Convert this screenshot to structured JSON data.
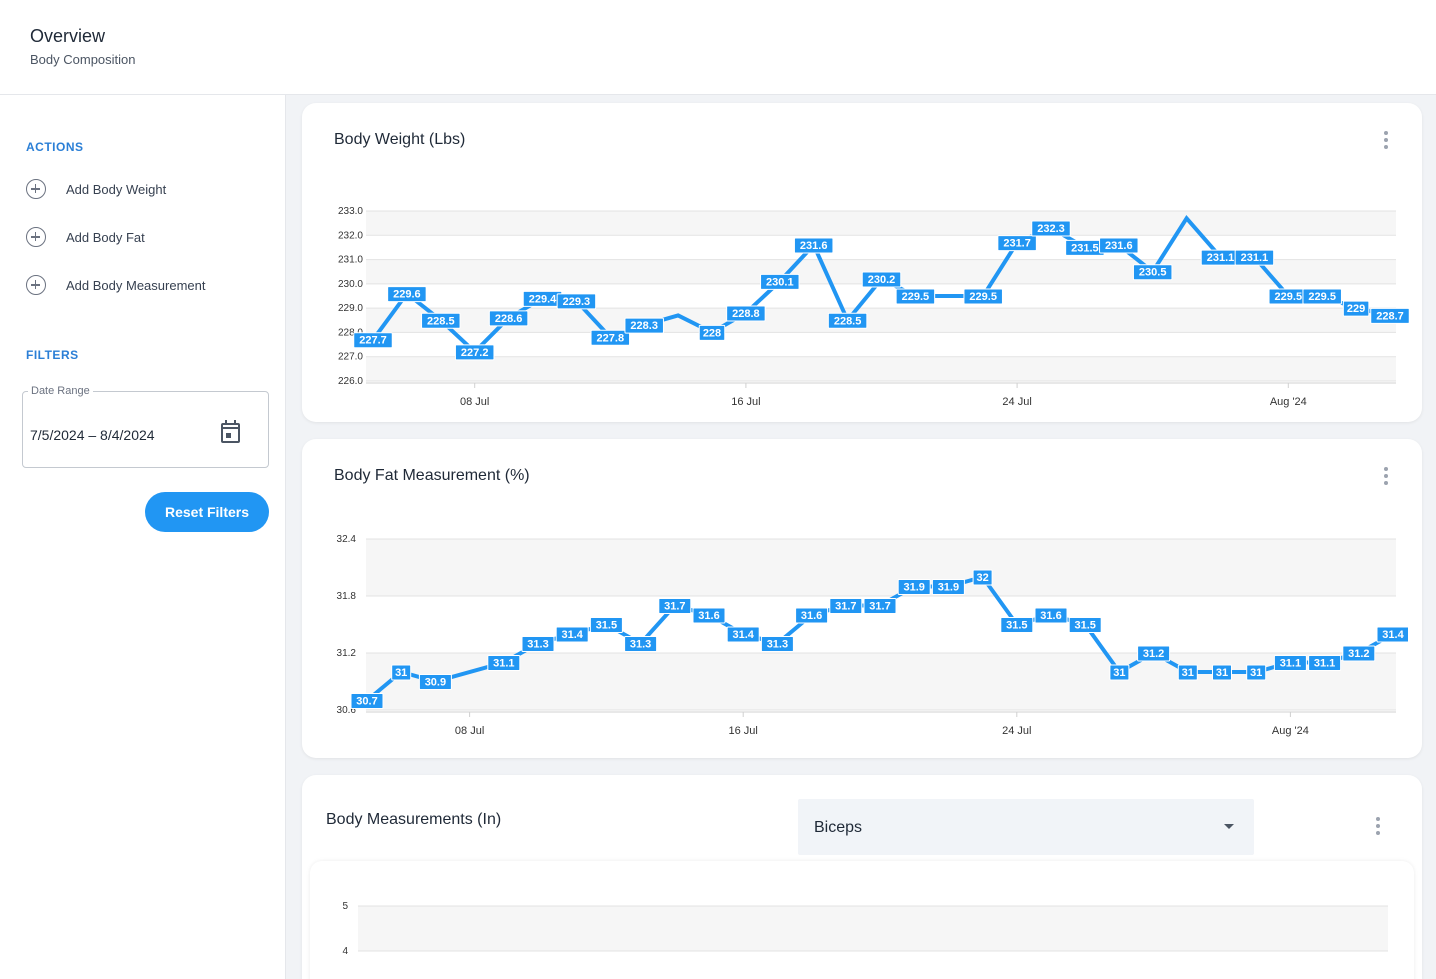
{
  "header": {
    "title": "Overview",
    "subtitle": "Body Composition"
  },
  "sidebar": {
    "actions_heading": "ACTIONS",
    "actions": [
      {
        "label": "Add Body Weight",
        "icon": "add-circle-icon"
      },
      {
        "label": "Add Body Fat",
        "icon": "add-circle-icon"
      },
      {
        "label": "Add Body Measurement",
        "icon": "add-circle-icon"
      }
    ],
    "filters_heading": "FILTERS",
    "date_range": {
      "label": "Date Range",
      "value": "7/5/2024 – 8/4/2024",
      "icon": "calendar-icon"
    },
    "reset_label": "Reset Filters"
  },
  "colors": {
    "accent": "#2196f3",
    "line": "#2196f3",
    "label_bg": "#2196f3",
    "heading": "#2b7fd6"
  },
  "cards": {
    "weight": {
      "title": "Body Weight (Lbs)"
    },
    "fat": {
      "title": "Body Fat Measurement (%)"
    },
    "measure": {
      "title": "Body Measurements (In)",
      "select_value": "Biceps"
    }
  },
  "chart_data": [
    {
      "type": "line",
      "title": "Body Weight (Lbs)",
      "x_start": "2024-07-05",
      "x_ticks": [
        {
          "label": "08 Jul",
          "x": "2024-07-08"
        },
        {
          "label": "16 Jul",
          "x": "2024-07-16"
        },
        {
          "label": "24 Jul",
          "x": "2024-07-24"
        },
        {
          "label": "Aug '24",
          "x": "2024-08-01"
        }
      ],
      "y_ticks": [
        "233.0",
        "232.0",
        "231.0",
        "230.0",
        "229.0",
        "228.0",
        "227.0",
        "226.0"
      ],
      "ylim": [
        226,
        233
      ],
      "grid": true,
      "series": [
        {
          "points": [
            {
              "x": "2024-07-05",
              "y": 227.7,
              "label": "227.7"
            },
            {
              "x": "2024-07-06",
              "y": 229.6,
              "label": "229.6"
            },
            {
              "x": "2024-07-07",
              "y": 228.5,
              "label": "228.5"
            },
            {
              "x": "2024-07-08",
              "y": 227.2,
              "label": "227.2"
            },
            {
              "x": "2024-07-09",
              "y": 228.6,
              "label": "228.6"
            },
            {
              "x": "2024-07-10",
              "y": 229.4,
              "label": "229.4"
            },
            {
              "x": "2024-07-11",
              "y": 229.3,
              "label": "229.3"
            },
            {
              "x": "2024-07-12",
              "y": 227.8,
              "label": "227.8"
            },
            {
              "x": "2024-07-13",
              "y": 228.3,
              "label": "228.3"
            },
            {
              "x": "2024-07-14",
              "y": 228.7,
              "label": null
            },
            {
              "x": "2024-07-15",
              "y": 228,
              "label": "228"
            },
            {
              "x": "2024-07-16",
              "y": 228.8,
              "label": "228.8"
            },
            {
              "x": "2024-07-17",
              "y": 230.1,
              "label": "230.1"
            },
            {
              "x": "2024-07-18",
              "y": 231.6,
              "label": "231.6"
            },
            {
              "x": "2024-07-19",
              "y": 228.5,
              "label": "228.5"
            },
            {
              "x": "2024-07-20",
              "y": 230.2,
              "label": "230.2"
            },
            {
              "x": "2024-07-21",
              "y": 229.5,
              "label": "229.5"
            },
            {
              "x": "2024-07-23",
              "y": 229.5,
              "label": "229.5"
            },
            {
              "x": "2024-07-24",
              "y": 231.7,
              "label": "231.7"
            },
            {
              "x": "2024-07-25",
              "y": 232.3,
              "label": "232.3"
            },
            {
              "x": "2024-07-26",
              "y": 231.5,
              "label": "231.5"
            },
            {
              "x": "2024-07-27",
              "y": 231.6,
              "label": "231.6"
            },
            {
              "x": "2024-07-28",
              "y": 230.5,
              "label": "230.5"
            },
            {
              "x": "2024-07-29",
              "y": 232.7,
              "label": null
            },
            {
              "x": "2024-07-30",
              "y": 231.1,
              "label": "231.1"
            },
            {
              "x": "2024-07-31",
              "y": 231.1,
              "label": "231.1"
            },
            {
              "x": "2024-08-01",
              "y": 229.5,
              "label": "229.5"
            },
            {
              "x": "2024-08-02",
              "y": 229.5,
              "label": "229.5"
            },
            {
              "x": "2024-08-03",
              "y": 229,
              "label": "229"
            },
            {
              "x": "2024-08-04",
              "y": 228.7,
              "label": "228.7"
            }
          ]
        }
      ]
    },
    {
      "type": "line",
      "title": "Body Fat Measurement (%)",
      "x_start": "2024-07-05",
      "x_ticks": [
        {
          "label": "08 Jul",
          "x": "2024-07-08"
        },
        {
          "label": "16 Jul",
          "x": "2024-07-16"
        },
        {
          "label": "24 Jul",
          "x": "2024-07-24"
        },
        {
          "label": "Aug '24",
          "x": "2024-08-01"
        }
      ],
      "y_ticks": [
        "32.4",
        "31.8",
        "31.2",
        "30.6"
      ],
      "ylim": [
        30.6,
        32.4
      ],
      "grid": true,
      "series": [
        {
          "points": [
            {
              "x": "2024-07-05",
              "y": 30.7,
              "label": "30.7"
            },
            {
              "x": "2024-07-06",
              "y": 31,
              "label": "31"
            },
            {
              "x": "2024-07-07",
              "y": 30.9,
              "label": "30.9"
            },
            {
              "x": "2024-07-09",
              "y": 31.1,
              "label": "31.1"
            },
            {
              "x": "2024-07-10",
              "y": 31.3,
              "label": "31.3"
            },
            {
              "x": "2024-07-11",
              "y": 31.4,
              "label": "31.4"
            },
            {
              "x": "2024-07-12",
              "y": 31.5,
              "label": "31.5"
            },
            {
              "x": "2024-07-13",
              "y": 31.3,
              "label": "31.3"
            },
            {
              "x": "2024-07-14",
              "y": 31.7,
              "label": "31.7"
            },
            {
              "x": "2024-07-15",
              "y": 31.6,
              "label": "31.6"
            },
            {
              "x": "2024-07-16",
              "y": 31.4,
              "label": "31.4"
            },
            {
              "x": "2024-07-17",
              "y": 31.3,
              "label": "31.3"
            },
            {
              "x": "2024-07-18",
              "y": 31.6,
              "label": "31.6"
            },
            {
              "x": "2024-07-19",
              "y": 31.7,
              "label": "31.7"
            },
            {
              "x": "2024-07-20",
              "y": 31.7,
              "label": "31.7"
            },
            {
              "x": "2024-07-21",
              "y": 31.9,
              "label": "31.9"
            },
            {
              "x": "2024-07-22",
              "y": 31.9,
              "label": "31.9"
            },
            {
              "x": "2024-07-23",
              "y": 32,
              "label": "32"
            },
            {
              "x": "2024-07-24",
              "y": 31.5,
              "label": "31.5"
            },
            {
              "x": "2024-07-25",
              "y": 31.6,
              "label": "31.6"
            },
            {
              "x": "2024-07-26",
              "y": 31.5,
              "label": "31.5"
            },
            {
              "x": "2024-07-27",
              "y": 31,
              "label": "31"
            },
            {
              "x": "2024-07-28",
              "y": 31.2,
              "label": "31.2"
            },
            {
              "x": "2024-07-29",
              "y": 31,
              "label": "31"
            },
            {
              "x": "2024-07-30",
              "y": 31,
              "label": "31"
            },
            {
              "x": "2024-07-31",
              "y": 31,
              "label": "31"
            },
            {
              "x": "2024-08-01",
              "y": 31.1,
              "label": "31.1"
            },
            {
              "x": "2024-08-02",
              "y": 31.1,
              "label": "31.1"
            },
            {
              "x": "2024-08-03",
              "y": 31.2,
              "label": "31.2"
            },
            {
              "x": "2024-08-04",
              "y": 31.4,
              "label": "31.4"
            }
          ]
        }
      ]
    },
    {
      "type": "line",
      "title": "Body Measurements (In)",
      "y_ticks": [
        "5",
        "4"
      ],
      "grid": true,
      "series": []
    }
  ]
}
